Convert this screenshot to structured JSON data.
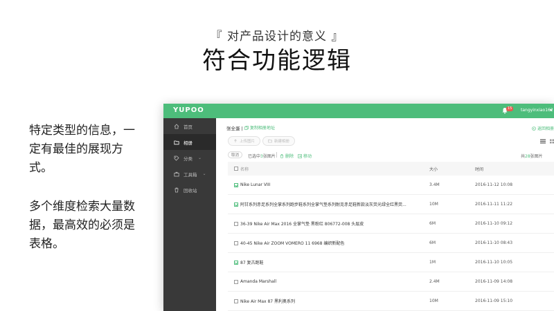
{
  "slide": {
    "subtitle": "『 对产品设计的意义 』",
    "title": "符合功能逻辑",
    "para1": "特定类型的信息，一定有最佳的展现方式。",
    "para2": "多个维度检索大量数据，最高效的必须是表格。"
  },
  "app": {
    "logo": "YUPOO",
    "notification_count": "15",
    "username": "tangyinxiao162",
    "sidebar": [
      {
        "label": "首页",
        "icon": "home-icon",
        "active": false
      },
      {
        "label": "相册",
        "icon": "folder-icon",
        "active": true
      },
      {
        "label": "分类",
        "icon": "tag-icon",
        "active": false,
        "caret": true
      },
      {
        "label": "工具箱",
        "icon": "toolbox-icon",
        "active": false,
        "caret": true
      },
      {
        "label": "回收站",
        "icon": "trash-icon",
        "active": false
      }
    ],
    "breadcrumb": "张全蛋 |",
    "copy_link": "复制相册地址",
    "back_link": "返回相册",
    "upload_button": "上传图片",
    "new_album_button": "新建相册",
    "cancel_button": "取消",
    "selected_prefix": "已选中",
    "selected_count": "3",
    "selected_suffix": "张图片",
    "delete_label": "删除",
    "move_label": "移动",
    "total_prefix": "共",
    "total_count": "28",
    "total_suffix": "张图片",
    "columns": {
      "name": "名称",
      "size": "大小",
      "time": "时间"
    },
    "rows": [
      {
        "name": "Nike Lunar VIII",
        "size": "3.4M",
        "time": "2016-11-12 10:08",
        "checked": true
      },
      {
        "name": "阿甘系列赤足系列全掌系列跑步鞋系列全掌气垫系列耐克赤足鞋新款淡灰荧光绿全红黑荧...",
        "size": "10M",
        "time": "2016-11-11 11:22",
        "checked": true
      },
      {
        "name": "36-39 Nike Air Max 2016 全掌气垫 黑粉红 806772-008 头层皮",
        "size": "6M",
        "time": "2016-11-10 09:12",
        "checked": false
      },
      {
        "name": "40-45 Nike Air ZOOM VOMERO 11 6968 编织新配色",
        "size": "6M",
        "time": "2016-11-10 08:43",
        "checked": false
      },
      {
        "name": "87 复古跑鞋",
        "size": "1M",
        "time": "2016-11-10 10:05",
        "checked": true
      },
      {
        "name": "Amanda Marshall",
        "size": "2.4M",
        "time": "2016-11-09 14:08",
        "checked": false
      },
      {
        "name": "Nike Air Max 87 黑利奥系列",
        "size": "10M",
        "time": "2016-11-09 15:10",
        "checked": false
      }
    ]
  }
}
